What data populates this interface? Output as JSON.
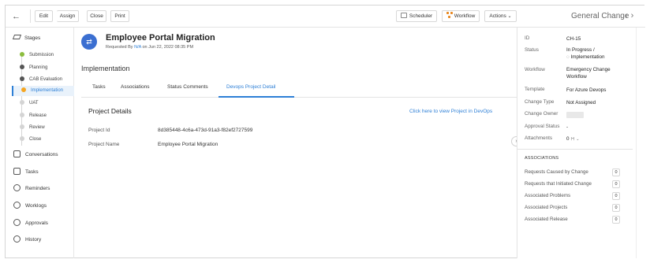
{
  "toolbar": {
    "back_icon": "arrow-left-icon",
    "edit_label": "Edit",
    "assign_label": "Assign",
    "close_label": "Close",
    "print_label": "Print",
    "scheduler_label": "Scheduler",
    "workflow_label": "Workflow",
    "actions_label": "Actions",
    "page_heading": "General Change",
    "prev_icon": "chevron-left-icon",
    "next_icon": "chevron-right-icon"
  },
  "sidebar": {
    "stages_label": "Stages",
    "stages": [
      {
        "label": "Submission",
        "color": "#8cbd3f"
      },
      {
        "label": "Planning",
        "color": "#555555"
      },
      {
        "label": "CAB Evaluation",
        "color": "#555555"
      },
      {
        "label": "Implementation",
        "color": "#f5a623",
        "active": true
      },
      {
        "label": "UAT",
        "color": "#d4d4d4"
      },
      {
        "label": "Release",
        "color": "#d4d4d4"
      },
      {
        "label": "Review",
        "color": "#d4d4d4"
      },
      {
        "label": "Close",
        "color": "#d4d4d4"
      }
    ],
    "links": [
      {
        "label": "Conversations",
        "icon": "chat-icon"
      },
      {
        "label": "Tasks",
        "icon": "checkbox-icon"
      },
      {
        "label": "Reminders",
        "icon": "alarm-icon"
      },
      {
        "label": "Worklogs",
        "icon": "stopwatch-icon"
      },
      {
        "label": "Approvals",
        "icon": "check-circle-icon"
      },
      {
        "label": "History",
        "icon": "history-icon"
      }
    ]
  },
  "request": {
    "title": "Employee Portal Migration",
    "requested_prefix": "Requested By",
    "requested_by": "N/A",
    "requested_on": "on Jun 22, 2022 08:35 PM"
  },
  "main": {
    "section_title": "Implementation",
    "tabs": [
      "Tasks",
      "Associations",
      "Status Comments",
      "Devops Project Detail"
    ],
    "active_tab": "Devops Project Detail",
    "project_details_title": "Project Details",
    "view_link": "Click here to view Project in DevOps",
    "fields": [
      {
        "label": "Project Id",
        "value": "8d385448-4c6a-473d-91a3-f82ef2727599"
      },
      {
        "label": "Project Name",
        "value": "Employee Portal Migration"
      }
    ]
  },
  "details": {
    "id_label": "ID",
    "id_value": "CH-15",
    "status_label": "Status",
    "status_value_1": "In Progress /",
    "status_value_2": "Implementation",
    "workflow_label": "Workflow",
    "workflow_value_1": "Emergency Change",
    "workflow_value_2": "Workflow",
    "template_label": "Template",
    "template_value": "For Azure Devops",
    "change_type_label": "Change Type",
    "change_type_value": "Not Assigned",
    "change_owner_label": "Change Owner",
    "approval_status_label": "Approval Status",
    "approval_status_value": "-",
    "attachments_label": "Attachments",
    "attachments_value": "0"
  },
  "associations": {
    "heading": "ASSOCIATIONS",
    "rows": [
      {
        "label": "Requests Caused by Change",
        "count": "0"
      },
      {
        "label": "Requests that Initiated Change",
        "count": "0"
      },
      {
        "label": "Associated Problems",
        "count": "0"
      },
      {
        "label": "Associated Projects",
        "count": "0"
      },
      {
        "label": "Associated Release",
        "count": "0"
      }
    ]
  },
  "colors": {
    "accent": "#2d7fd6",
    "request_icon": "#3b6fd1",
    "workflow_icon": "#e8871e"
  }
}
